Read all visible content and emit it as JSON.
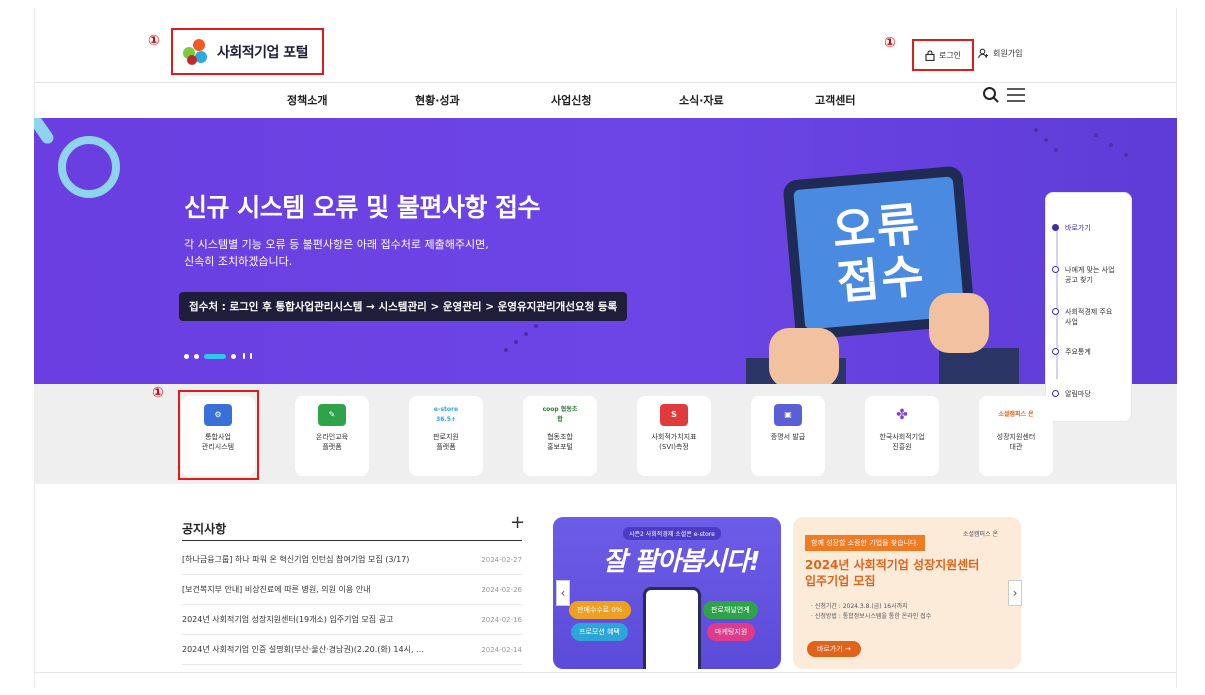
{
  "colors": {
    "accent": "#6a3ee0",
    "highlight": "#e01b1b",
    "orange": "#e0631b"
  },
  "annotations": {
    "marker": "①"
  },
  "header": {
    "logo_text": "사회적기업 포털",
    "login_label": "로그인",
    "signup_label": "회원가입"
  },
  "nav": {
    "items": [
      "정책소개",
      "현황·성과",
      "사업신청",
      "소식·자료",
      "고객센터"
    ]
  },
  "hero": {
    "title": "신규 시스템 오류 및 불편사항 접수",
    "desc_line1": "각 시스템별 기능 오류 등 불편사항은 아래 접수처로 제출해주시면,",
    "desc_line2": "신속히 조치하겠습니다.",
    "path": "접수처 : 로그인 후 통합사업관리시스템 → 시스템관리 > 운영관리 > 운영유지관리개선요청 등록",
    "tablet_line1": "오류",
    "tablet_line2": "접수"
  },
  "quick_nav": {
    "items": [
      "바로가기",
      "나에게 맞는 사업공고 찾기",
      "사회적경제 주요사업",
      "주요통계",
      "알림마당"
    ]
  },
  "quick_menu": {
    "items": [
      {
        "line1": "통합사업",
        "line2": "관리시스템",
        "icon": "gear-screen-icon",
        "icon_text": "⚙"
      },
      {
        "line1": "온라인교육",
        "line2": "플랫폼",
        "icon": "edit-icon",
        "icon_text": "✎"
      },
      {
        "line1": "판로지원",
        "line2": "플랫폼",
        "icon": "estore-logo",
        "icon_text": "e-store 36.5+"
      },
      {
        "line1": "협동조합",
        "line2": "홍보포털",
        "icon": "coop-logo",
        "icon_text": "coop 협동조합"
      },
      {
        "line1": "사회적가치지표",
        "line2": "(SVI)측정",
        "icon": "svi-icon",
        "icon_text": "S"
      },
      {
        "line1": "증명서 발급",
        "line2": "",
        "icon": "certificate-icon",
        "icon_text": "▣"
      },
      {
        "line1": "한국사회적기업",
        "line2": "진흥원",
        "icon": "kosea-logo",
        "icon_text": "✤"
      },
      {
        "line1": "성장지원센터",
        "line2": "대관",
        "icon": "growth-center-logo",
        "icon_text": "소셜캠퍼스 온"
      }
    ]
  },
  "notices": {
    "title": "공지사항",
    "more": "+",
    "items": [
      {
        "text": "[하나금융그룹] 하나 파워 온 혁신기업 인턴십 참여기업 모집 (3/17)",
        "date": "2024-02-27"
      },
      {
        "text": "[보건복지부 안내] 비상진료에 따른 병원, 의원 이용 안내",
        "date": "2024-02-26"
      },
      {
        "text": "2024년 사회적기업 성장지원센터(19개소) 입주기업 모집 공고",
        "date": "2024-02-16"
      },
      {
        "text": "2024년 사회적기업 인증 설명회(부산·울산·경남권)(2.20.(화) 14시, …",
        "date": "2024-02-14"
      }
    ]
  },
  "banner1": {
    "tag": "시즌2 사회적경제 소셜콘 e-store",
    "title": "잘 팔아봅시다!",
    "pill1": "판매수수료 0%",
    "pill2": "프로모션 혜택",
    "pill3": "판로채널연계",
    "pill4": "마케팅지원"
  },
  "banner2": {
    "tag": "함께 성장할 소중한 기업을 찾습니다.",
    "title_line1": "2024년 사회적기업 성장지원센터",
    "title_line2": "입주기업 모집",
    "desc_line1": "· 신청기간 : 2024.3.8.(금) 16시까지",
    "desc_line2": "· 신청방법 : 통합정보시스템을 통한 온라인 접수",
    "button": "바로가기 →",
    "logo": "소셜캠퍼스 온"
  }
}
